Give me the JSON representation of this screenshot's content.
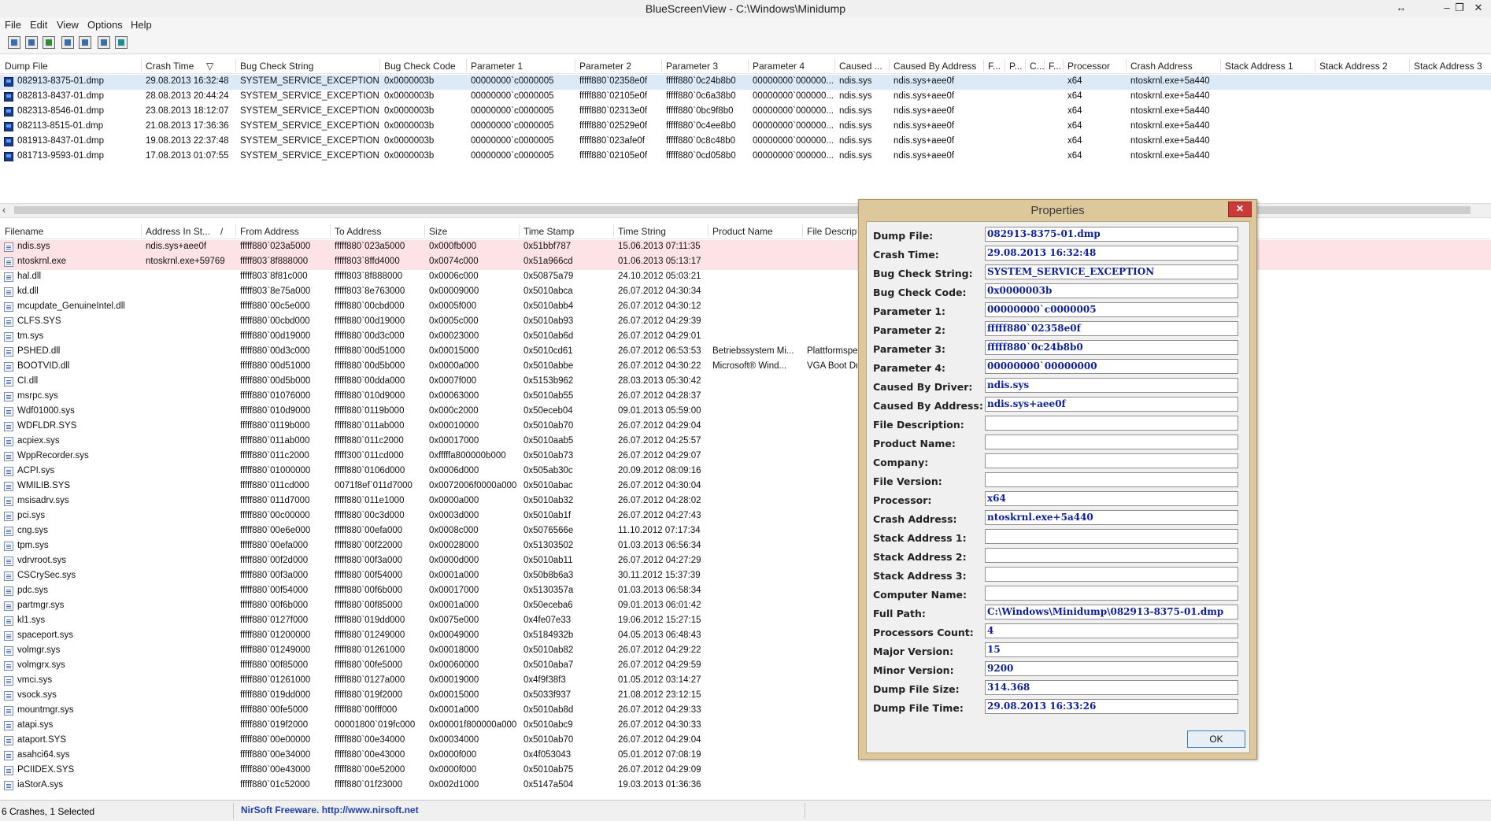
{
  "window": {
    "title": "BlueScreenView  -  C:\\Windows\\Minidump"
  },
  "menu": [
    "File",
    "Edit",
    "View",
    "Options",
    "Help"
  ],
  "toolbar": {
    "icons": [
      "properties-icon",
      "save-icon",
      "refresh-icon",
      "copy-icon",
      "html-report-icon",
      "find-icon",
      "exit-icon"
    ]
  },
  "crash_list": {
    "headers": [
      "Dump File",
      "Crash Time",
      "Bug Check String",
      "Bug Check Code",
      "Parameter 1",
      "Parameter 2",
      "Parameter 3",
      "Parameter 4",
      "Caused ...",
      "Caused By Address",
      "F...",
      "P...",
      "C...",
      "F...",
      "Processor",
      "Crash Address",
      "Stack Address 1",
      "Stack Address 2",
      "Stack Address 3"
    ],
    "sort_indicator": "▽",
    "rows": [
      [
        "082913-8375-01.dmp",
        "29.08.2013 16:32:48",
        "SYSTEM_SERVICE_EXCEPTION",
        "0x0000003b",
        "00000000`c0000005",
        "fffff880`02358e0f",
        "fffff880`0c24b8b0",
        "00000000`000000...",
        "ndis.sys",
        "ndis.sys+aee0f",
        "",
        "",
        "",
        "",
        "x64",
        "ntoskrnl.exe+5a440",
        "",
        "",
        ""
      ],
      [
        "082813-8437-01.dmp",
        "28.08.2013 20:44:24",
        "SYSTEM_SERVICE_EXCEPTION",
        "0x0000003b",
        "00000000`c0000005",
        "fffff880`02105e0f",
        "fffff880`0c6a38b0",
        "00000000`000000...",
        "ndis.sys",
        "ndis.sys+aee0f",
        "",
        "",
        "",
        "",
        "x64",
        "ntoskrnl.exe+5a440",
        "",
        "",
        ""
      ],
      [
        "082313-8546-01.dmp",
        "23.08.2013 18:12:07",
        "SYSTEM_SERVICE_EXCEPTION",
        "0x0000003b",
        "00000000`c0000005",
        "fffff880`02313e0f",
        "fffff880`0bc9f8b0",
        "00000000`000000...",
        "ndis.sys",
        "ndis.sys+aee0f",
        "",
        "",
        "",
        "",
        "x64",
        "ntoskrnl.exe+5a440",
        "",
        "",
        ""
      ],
      [
        "082113-8515-01.dmp",
        "21.08.2013 17:36:36",
        "SYSTEM_SERVICE_EXCEPTION",
        "0x0000003b",
        "00000000`c0000005",
        "fffff880`02529e0f",
        "fffff880`0c4ee8b0",
        "00000000`000000...",
        "ndis.sys",
        "ndis.sys+aee0f",
        "",
        "",
        "",
        "",
        "x64",
        "ntoskrnl.exe+5a440",
        "",
        "",
        ""
      ],
      [
        "081913-8437-01.dmp",
        "19.08.2013 22:37:48",
        "SYSTEM_SERVICE_EXCEPTION",
        "0x0000003b",
        "00000000`c0000005",
        "fffff880`023afe0f",
        "fffff880`0c8c48b0",
        "00000000`000000...",
        "ndis.sys",
        "ndis.sys+aee0f",
        "",
        "",
        "",
        "",
        "x64",
        "ntoskrnl.exe+5a440",
        "",
        "",
        ""
      ],
      [
        "081713-9593-01.dmp",
        "17.08.2013 01:07:55",
        "SYSTEM_SERVICE_EXCEPTION",
        "0x0000003b",
        "00000000`c0000005",
        "fffff880`02105e0f",
        "fffff880`0cd058b0",
        "00000000`000000...",
        "ndis.sys",
        "ndis.sys+aee0f",
        "",
        "",
        "",
        "",
        "x64",
        "ntoskrnl.exe+5a440",
        "",
        "",
        ""
      ]
    ]
  },
  "module_list": {
    "headers": [
      "Filename",
      "Address In St...",
      "From Address",
      "To Address",
      "Size",
      "Time Stamp",
      "Time String",
      "Product Name",
      "File Descript"
    ],
    "sort_indicator": "/",
    "rows": [
      [
        "ndis.sys",
        "ndis.sys+aee0f",
        "fffff880`023a5000",
        "fffff880`023a5000",
        "0x000fb000",
        "0x51bbf787",
        "15.06.2013 07:11:35",
        "",
        ""
      ],
      [
        "ntoskrnl.exe",
        "ntoskrnl.exe+59769",
        "fffff803`8f888000",
        "fffff803`8ffd4000",
        "0x0074c000",
        "0x51a966cd",
        "01.06.2013 05:13:17",
        "",
        ""
      ],
      [
        "hal.dll",
        "",
        "fffff803`8f81c000",
        "fffff803`8f888000",
        "0x0006c000",
        "0x50875a79",
        "24.10.2012 05:03:21",
        "",
        ""
      ],
      [
        "kd.dll",
        "",
        "fffff803`8e75a000",
        "fffff803`8e763000",
        "0x00009000",
        "0x5010abca",
        "26.07.2012 04:30:34",
        "",
        ""
      ],
      [
        "mcupdate_GenuineIntel.dll",
        "",
        "fffff880`00c5e000",
        "fffff880`00cbd000",
        "0x0005f000",
        "0x5010abb4",
        "26.07.2012 04:30:12",
        "",
        ""
      ],
      [
        "CLFS.SYS",
        "",
        "fffff880`00cbd000",
        "fffff880`00d19000",
        "0x0005c000",
        "0x5010ab93",
        "26.07.2012 04:29:39",
        "",
        ""
      ],
      [
        "tm.sys",
        "",
        "fffff880`00d19000",
        "fffff880`00d3c000",
        "0x00023000",
        "0x5010ab6d",
        "26.07.2012 04:29:01",
        "",
        ""
      ],
      [
        "PSHED.dll",
        "",
        "fffff880`00d3c000",
        "fffff880`00d51000",
        "0x00015000",
        "0x5010cd61",
        "26.07.2012 06:53:53",
        "Betriebssystem Mi...",
        "Plattformspe"
      ],
      [
        "BOOTVID.dll",
        "",
        "fffff880`00d51000",
        "fffff880`00d5b000",
        "0x0000a000",
        "0x5010abbe",
        "26.07.2012 04:30:22",
        "Microsoft® Wind...",
        "VGA Boot Dr"
      ],
      [
        "CI.dll",
        "",
        "fffff880`00d5b000",
        "fffff880`00dda000",
        "0x0007f000",
        "0x5153b962",
        "28.03.2013 05:30:42",
        "",
        ""
      ],
      [
        "msrpc.sys",
        "",
        "fffff880`01076000",
        "fffff880`010d9000",
        "0x00063000",
        "0x5010ab55",
        "26.07.2012 04:28:37",
        "",
        ""
      ],
      [
        "Wdf01000.sys",
        "",
        "fffff880`010d9000",
        "fffff880`0119b000",
        "0x000c2000",
        "0x50eceb04",
        "09.01.2013 05:59:00",
        "",
        ""
      ],
      [
        "WDFLDR.SYS",
        "",
        "fffff880`0119b000",
        "fffff880`011ab000",
        "0x00010000",
        "0x5010ab70",
        "26.07.2012 04:29:04",
        "",
        ""
      ],
      [
        "acpiex.sys",
        "",
        "fffff880`011ab000",
        "fffff880`011c2000",
        "0x00017000",
        "0x5010aab5",
        "26.07.2012 04:25:57",
        "",
        ""
      ],
      [
        "WppRecorder.sys",
        "",
        "fffff880`011c2000",
        "fffff300`011cd000",
        "0xfffffa800000b000",
        "0x5010ab73",
        "26.07.2012 04:29:07",
        "",
        ""
      ],
      [
        "ACPI.sys",
        "",
        "fffff880`01000000",
        "fffff880`0106d000",
        "0x0006d000",
        "0x505ab30c",
        "20.09.2012 08:09:16",
        "",
        ""
      ],
      [
        "WMILIB.SYS",
        "",
        "fffff880`011cd000",
        "0071f8ef`011d7000",
        "0x0072006f0000a000",
        "0x5010abac",
        "26.07.2012 04:30:04",
        "",
        ""
      ],
      [
        "msisadrv.sys",
        "",
        "fffff880`011d7000",
        "fffff880`011e1000",
        "0x0000a000",
        "0x5010ab32",
        "26.07.2012 04:28:02",
        "",
        ""
      ],
      [
        "pci.sys",
        "",
        "fffff880`00c00000",
        "fffff880`00c3d000",
        "0x0003d000",
        "0x5010ab1f",
        "26.07.2012 04:27:43",
        "",
        ""
      ],
      [
        "cng.sys",
        "",
        "fffff880`00e6e000",
        "fffff880`00efa000",
        "0x0008c000",
        "0x5076566e",
        "11.10.2012 07:17:34",
        "",
        ""
      ],
      [
        "tpm.sys",
        "",
        "fffff880`00efa000",
        "fffff880`00f22000",
        "0x00028000",
        "0x51303502",
        "01.03.2013 06:56:34",
        "",
        ""
      ],
      [
        "vdrvroot.sys",
        "",
        "fffff880`00f2d000",
        "fffff880`00f3a000",
        "0x0000d000",
        "0x5010ab11",
        "26.07.2012 04:27:29",
        "",
        ""
      ],
      [
        "CSCrySec.sys",
        "",
        "fffff880`00f3a000",
        "fffff880`00f54000",
        "0x0001a000",
        "0x50b8b6a3",
        "30.11.2012 15:37:39",
        "",
        ""
      ],
      [
        "pdc.sys",
        "",
        "fffff880`00f54000",
        "fffff880`00f6b000",
        "0x00017000",
        "0x5130357a",
        "01.03.2013 06:58:34",
        "",
        ""
      ],
      [
        "partmgr.sys",
        "",
        "fffff880`00f6b000",
        "fffff880`00f85000",
        "0x0001a000",
        "0x50eceba6",
        "09.01.2013 06:01:42",
        "",
        ""
      ],
      [
        "kl1.sys",
        "",
        "fffff880`0127f000",
        "fffff880`019dd000",
        "0x0075e000",
        "0x4fe07e33",
        "19.06.2012 15:27:15",
        "",
        ""
      ],
      [
        "spaceport.sys",
        "",
        "fffff880`01200000",
        "fffff880`01249000",
        "0x00049000",
        "0x5184932b",
        "04.05.2013 06:48:43",
        "",
        ""
      ],
      [
        "volmgr.sys",
        "",
        "fffff880`01249000",
        "fffff880`01261000",
        "0x00018000",
        "0x5010ab82",
        "26.07.2012 04:29:22",
        "",
        ""
      ],
      [
        "volmgrx.sys",
        "",
        "fffff880`00f85000",
        "fffff880`00fe5000",
        "0x00060000",
        "0x5010aba7",
        "26.07.2012 04:29:59",
        "",
        ""
      ],
      [
        "vmci.sys",
        "",
        "fffff880`01261000",
        "fffff880`0127a000",
        "0x00019000",
        "0x4f9f38f3",
        "01.05.2012 03:14:27",
        "",
        ""
      ],
      [
        "vsock.sys",
        "",
        "fffff880`019dd000",
        "fffff880`019f2000",
        "0x00015000",
        "0x5033f937",
        "21.08.2012 23:12:15",
        "",
        ""
      ],
      [
        "mountmgr.sys",
        "",
        "fffff880`00fe5000",
        "fffff880`00fff000",
        "0x0001a000",
        "0x5010ab8d",
        "26.07.2012 04:29:33",
        "",
        ""
      ],
      [
        "atapi.sys",
        "",
        "fffff880`019f2000",
        "00001800`019fc000",
        "0x00001f800000a000",
        "0x5010abc9",
        "26.07.2012 04:30:33",
        "",
        ""
      ],
      [
        "ataport.SYS",
        "",
        "fffff880`00e00000",
        "fffff880`00e34000",
        "0x00034000",
        "0x5010ab70",
        "26.07.2012 04:29:04",
        "",
        ""
      ],
      [
        "asahci64.sys",
        "",
        "fffff880`00e34000",
        "fffff880`00e43000",
        "0x0000f000",
        "0x4f053043",
        "05.01.2012 07:08:19",
        "",
        ""
      ],
      [
        "PCIIDEX.SYS",
        "",
        "fffff880`00e43000",
        "fffff880`00e52000",
        "0x0000f000",
        "0x5010ab75",
        "26.07.2012 04:29:09",
        "",
        ""
      ],
      [
        "iaStorA.sys",
        "",
        "fffff880`01c52000",
        "fffff880`01f23000",
        "0x002d1000",
        "0x5147a504",
        "19.03.2013 01:36:36",
        "",
        ""
      ]
    ]
  },
  "status": {
    "count": "6 Crashes, 1 Selected",
    "freeware": "NirSoft Freeware.  http://www.nirsoft.net"
  },
  "properties": {
    "title": "Properties",
    "close_label": "✕",
    "ok_label": "OK",
    "fields": [
      {
        "label": "Dump File:",
        "value": "082913-8375-01.dmp"
      },
      {
        "label": "Crash Time:",
        "value": "29.08.2013 16:32:48"
      },
      {
        "label": "Bug Check String:",
        "value": "SYSTEM_SERVICE_EXCEPTION"
      },
      {
        "label": "Bug Check Code:",
        "value": "0x0000003b"
      },
      {
        "label": "Parameter 1:",
        "value": "00000000`c0000005"
      },
      {
        "label": "Parameter 2:",
        "value": "fffff880`02358e0f"
      },
      {
        "label": "Parameter 3:",
        "value": "fffff880`0c24b8b0"
      },
      {
        "label": "Parameter 4:",
        "value": "00000000`00000000"
      },
      {
        "label": "Caused By Driver:",
        "value": "ndis.sys"
      },
      {
        "label": "Caused By Address:",
        "value": "ndis.sys+aee0f"
      },
      {
        "label": "File Description:",
        "value": ""
      },
      {
        "label": "Product Name:",
        "value": ""
      },
      {
        "label": "Company:",
        "value": ""
      },
      {
        "label": "File Version:",
        "value": ""
      },
      {
        "label": "Processor:",
        "value": "x64"
      },
      {
        "label": "Crash Address:",
        "value": "ntoskrnl.exe+5a440"
      },
      {
        "label": "Stack Address 1:",
        "value": ""
      },
      {
        "label": "Stack Address 2:",
        "value": ""
      },
      {
        "label": "Stack Address 3:",
        "value": ""
      },
      {
        "label": "Computer Name:",
        "value": ""
      },
      {
        "label": "Full Path:",
        "value": "C:\\Windows\\Minidump\\082913-8375-01.dmp"
      },
      {
        "label": "Processors Count:",
        "value": "4"
      },
      {
        "label": "Major Version:",
        "value": "15"
      },
      {
        "label": "Minor Version:",
        "value": "9200"
      },
      {
        "label": "Dump File Size:",
        "value": "314.368"
      },
      {
        "label": "Dump File Time:",
        "value": "29.08.2013 16:33:26"
      }
    ]
  },
  "colors": {
    "selected_row": "#dce9f7",
    "highlighted_row": "#fde2e6",
    "dialog_frame": "#dcc89a",
    "value_text": "#0c1f9a",
    "link_text": "#1f3faa"
  }
}
